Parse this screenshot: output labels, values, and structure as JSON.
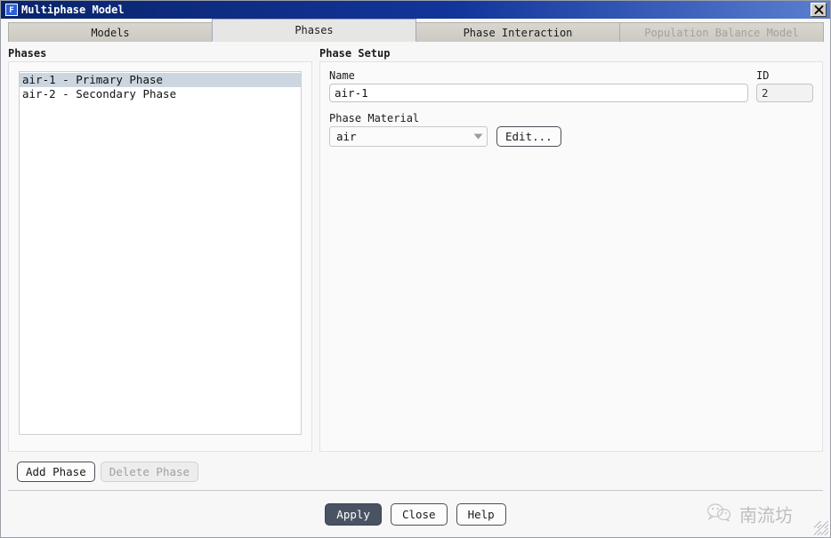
{
  "window": {
    "title": "Multiphase Model",
    "icon_label": "F",
    "icon_name": "fluent-app-icon",
    "close_icon": "close-icon"
  },
  "tabs": [
    {
      "label": "Models",
      "state": "normal"
    },
    {
      "label": "Phases",
      "state": "active"
    },
    {
      "label": "Phase Interaction",
      "state": "normal"
    },
    {
      "label": "Population Balance Model",
      "state": "disabled"
    }
  ],
  "phases_panel": {
    "title": "Phases",
    "items": [
      {
        "label": "air-1 - Primary Phase",
        "selected": true
      },
      {
        "label": "air-2 - Secondary Phase",
        "selected": false
      }
    ],
    "add_phase_label": "Add Phase",
    "delete_phase_label": "Delete Phase",
    "delete_phase_enabled": false
  },
  "phase_setup": {
    "title": "Phase Setup",
    "name_label": "Name",
    "name_value": "air-1",
    "id_label": "ID",
    "id_value": "2",
    "material_label": "Phase Material",
    "material_value": "air",
    "material_arrow_icon": "chevron-down-icon",
    "edit_label": "Edit..."
  },
  "footer": {
    "apply_label": "Apply",
    "close_label": "Close",
    "help_label": "Help"
  },
  "watermark": {
    "text": "南流坊",
    "icon": "wechat-icon"
  },
  "colors": {
    "titlebar_start": "#0a246a",
    "titlebar_end": "#5a7fd0",
    "selection": "#ccd6e0",
    "default_button": "#4a5363",
    "dialog_bg": "#f7f7f8"
  }
}
